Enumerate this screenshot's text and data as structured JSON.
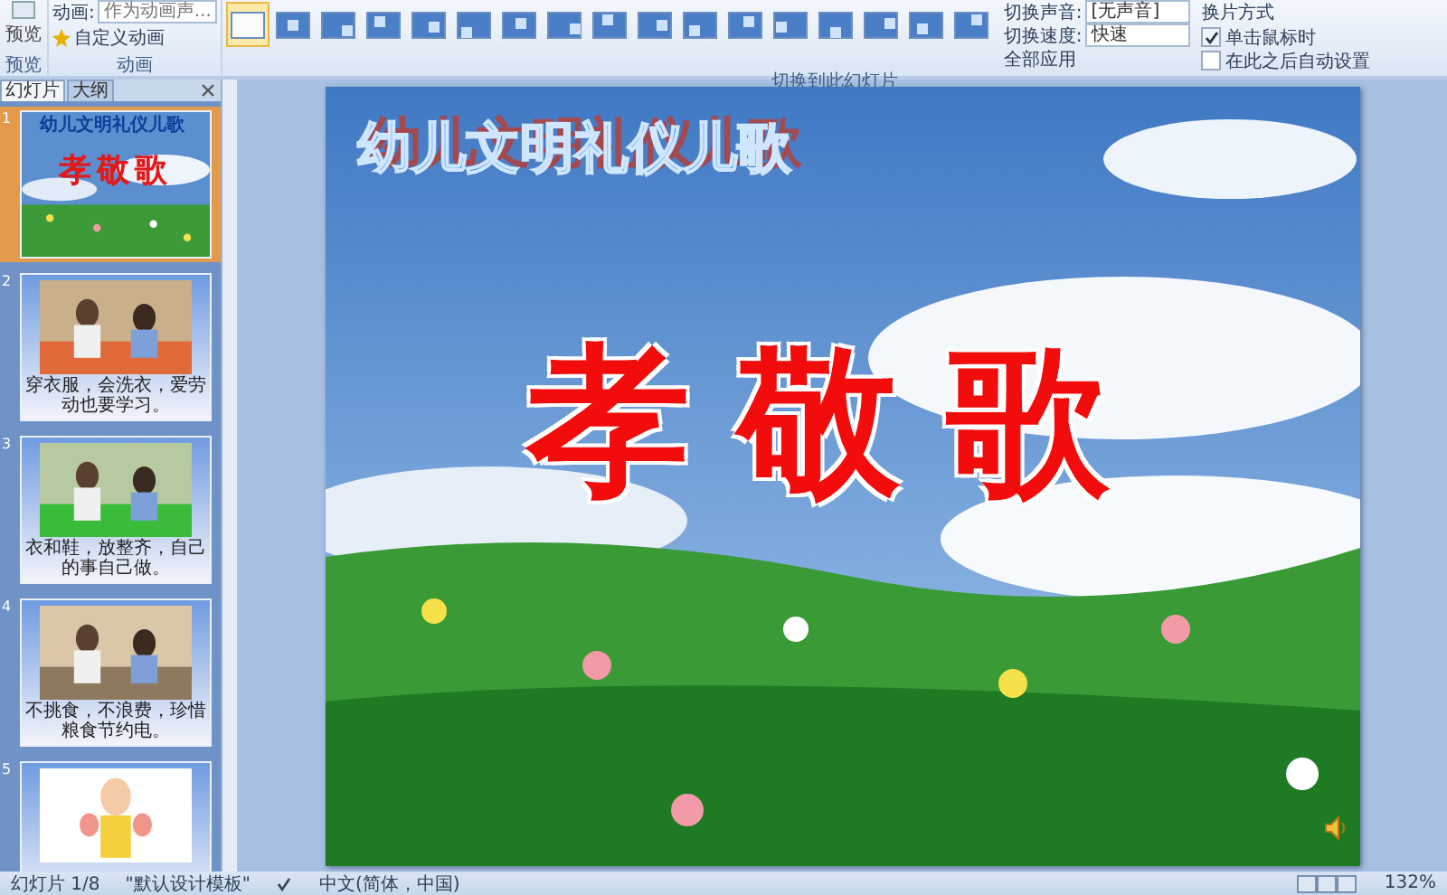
{
  "ribbon": {
    "preview": {
      "label": "预览",
      "group": "预览"
    },
    "animation": {
      "label": "动画:",
      "select": "作为动画声...",
      "custom": "自定义动画",
      "group": "动画"
    },
    "transitions": [
      {
        "selected": true
      },
      {
        "selected": false
      },
      {
        "selected": false
      },
      {
        "selected": false
      },
      {
        "selected": false
      },
      {
        "selected": false
      },
      {
        "selected": false
      },
      {
        "selected": false
      },
      {
        "selected": false
      },
      {
        "selected": false
      },
      {
        "selected": false
      },
      {
        "selected": false
      },
      {
        "selected": false
      },
      {
        "selected": false
      },
      {
        "selected": false
      },
      {
        "selected": false
      },
      {
        "selected": false
      }
    ],
    "settings": {
      "sound_label": "切换声音:",
      "sound_value": "[无声音]",
      "speed_label": "切换速度:",
      "speed_value": "快速",
      "apply_all": "全部应用",
      "advance_title": "换片方式",
      "advance_options": [
        {
          "label": "单击鼠标时",
          "checked": true
        },
        {
          "label": "在此之后自动设置",
          "checked": false
        }
      ]
    },
    "group": "切换到此幻灯片"
  },
  "panel": {
    "tabs": [
      {
        "label": "幻灯片",
        "selected": true
      },
      {
        "label": "大纲",
        "selected": false
      }
    ],
    "thumbnails": [
      {
        "number": "1",
        "selected": true,
        "kind": "title",
        "heading": "幼儿文明礼仪儿歌",
        "title": "孝敬歌"
      },
      {
        "number": "2",
        "selected": false,
        "caption": "穿衣服，会洗衣，爱劳动也要学习。"
      },
      {
        "number": "3",
        "selected": false,
        "caption": "衣和鞋，放整齐，自己的事自己做。"
      },
      {
        "number": "4",
        "selected": false,
        "caption": "不挑食，不浪费，珍惜粮食节约电。"
      },
      {
        "number": "5",
        "selected": false,
        "kind": "cartoon"
      }
    ]
  },
  "slide": {
    "heading": "幼儿文明礼仪儿歌",
    "title": "孝敬歌"
  },
  "status_bar": {
    "slide": "幻灯片 1/8",
    "theme": "\"默认设计模板\"",
    "language": "中文(简体，中国)",
    "zoom": "132%"
  }
}
